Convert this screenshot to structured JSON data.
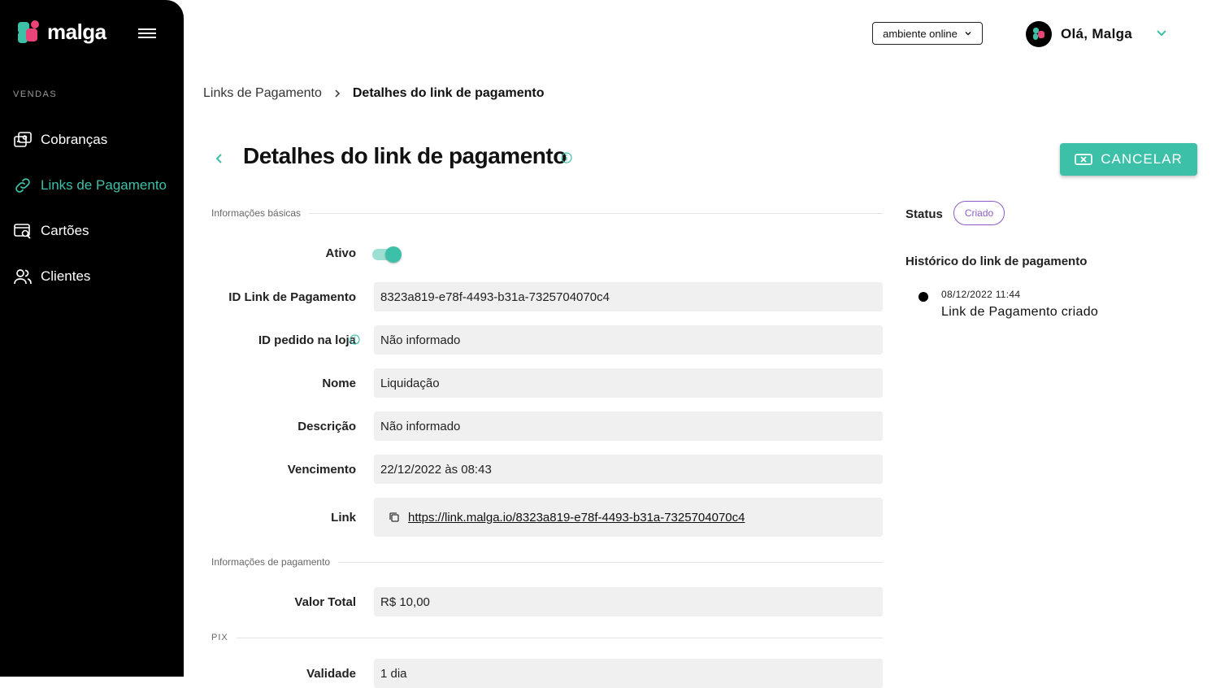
{
  "app": {
    "brand": "malga"
  },
  "sidebar": {
    "section_label": "VENDAS",
    "items": [
      {
        "label": "Cobranças",
        "icon": "charges-icon"
      },
      {
        "label": "Links de Pagamento",
        "icon": "link-icon",
        "active": true
      },
      {
        "label": "Cartões",
        "icon": "card-search-icon"
      },
      {
        "label": "Clientes",
        "icon": "users-icon"
      }
    ]
  },
  "header": {
    "environment": "ambiente online",
    "greeting": "Olá, Malga"
  },
  "breadcrumb": {
    "parent": "Links de Pagamento",
    "current": "Detalhes do link de pagamento"
  },
  "page": {
    "title": "Detalhes do link de pagamento",
    "cancel_label": "CANCELAR"
  },
  "sections": {
    "basic": "Informações básicas",
    "payment": "Informações de pagamento",
    "pix": "PIX"
  },
  "fields": {
    "active_label": "Ativo",
    "active_value": true,
    "id_label": "ID Link de Pagamento",
    "id_value": "8323a819-e78f-4493-b31a-7325704070c4",
    "order_label": "ID pedido na loja",
    "order_value": "Não informado",
    "name_label": "Nome",
    "name_value": "Liquidação",
    "desc_label": "Descrição",
    "desc_value": "Não informado",
    "due_label": "Vencimento",
    "due_value": "22/12/2022 às 08:43",
    "link_label": "Link",
    "link_value": "https://link.malga.io/8323a819-e78f-4493-b31a-7325704070c4",
    "total_label": "Valor Total",
    "total_value": "R$ 10,00",
    "validity_label": "Validade",
    "validity_value": "1 dia"
  },
  "status": {
    "label": "Status",
    "value": "Criado",
    "color": "#8e5cc8"
  },
  "history": {
    "title": "Histórico do link de pagamento",
    "events": [
      {
        "date": "08/12/2022 11:44",
        "text": "Link de Pagamento criado"
      }
    ]
  },
  "colors": {
    "accent": "#3cc0a8",
    "brand_pink": "#e8447a",
    "sidebar_bg": "#000000"
  }
}
